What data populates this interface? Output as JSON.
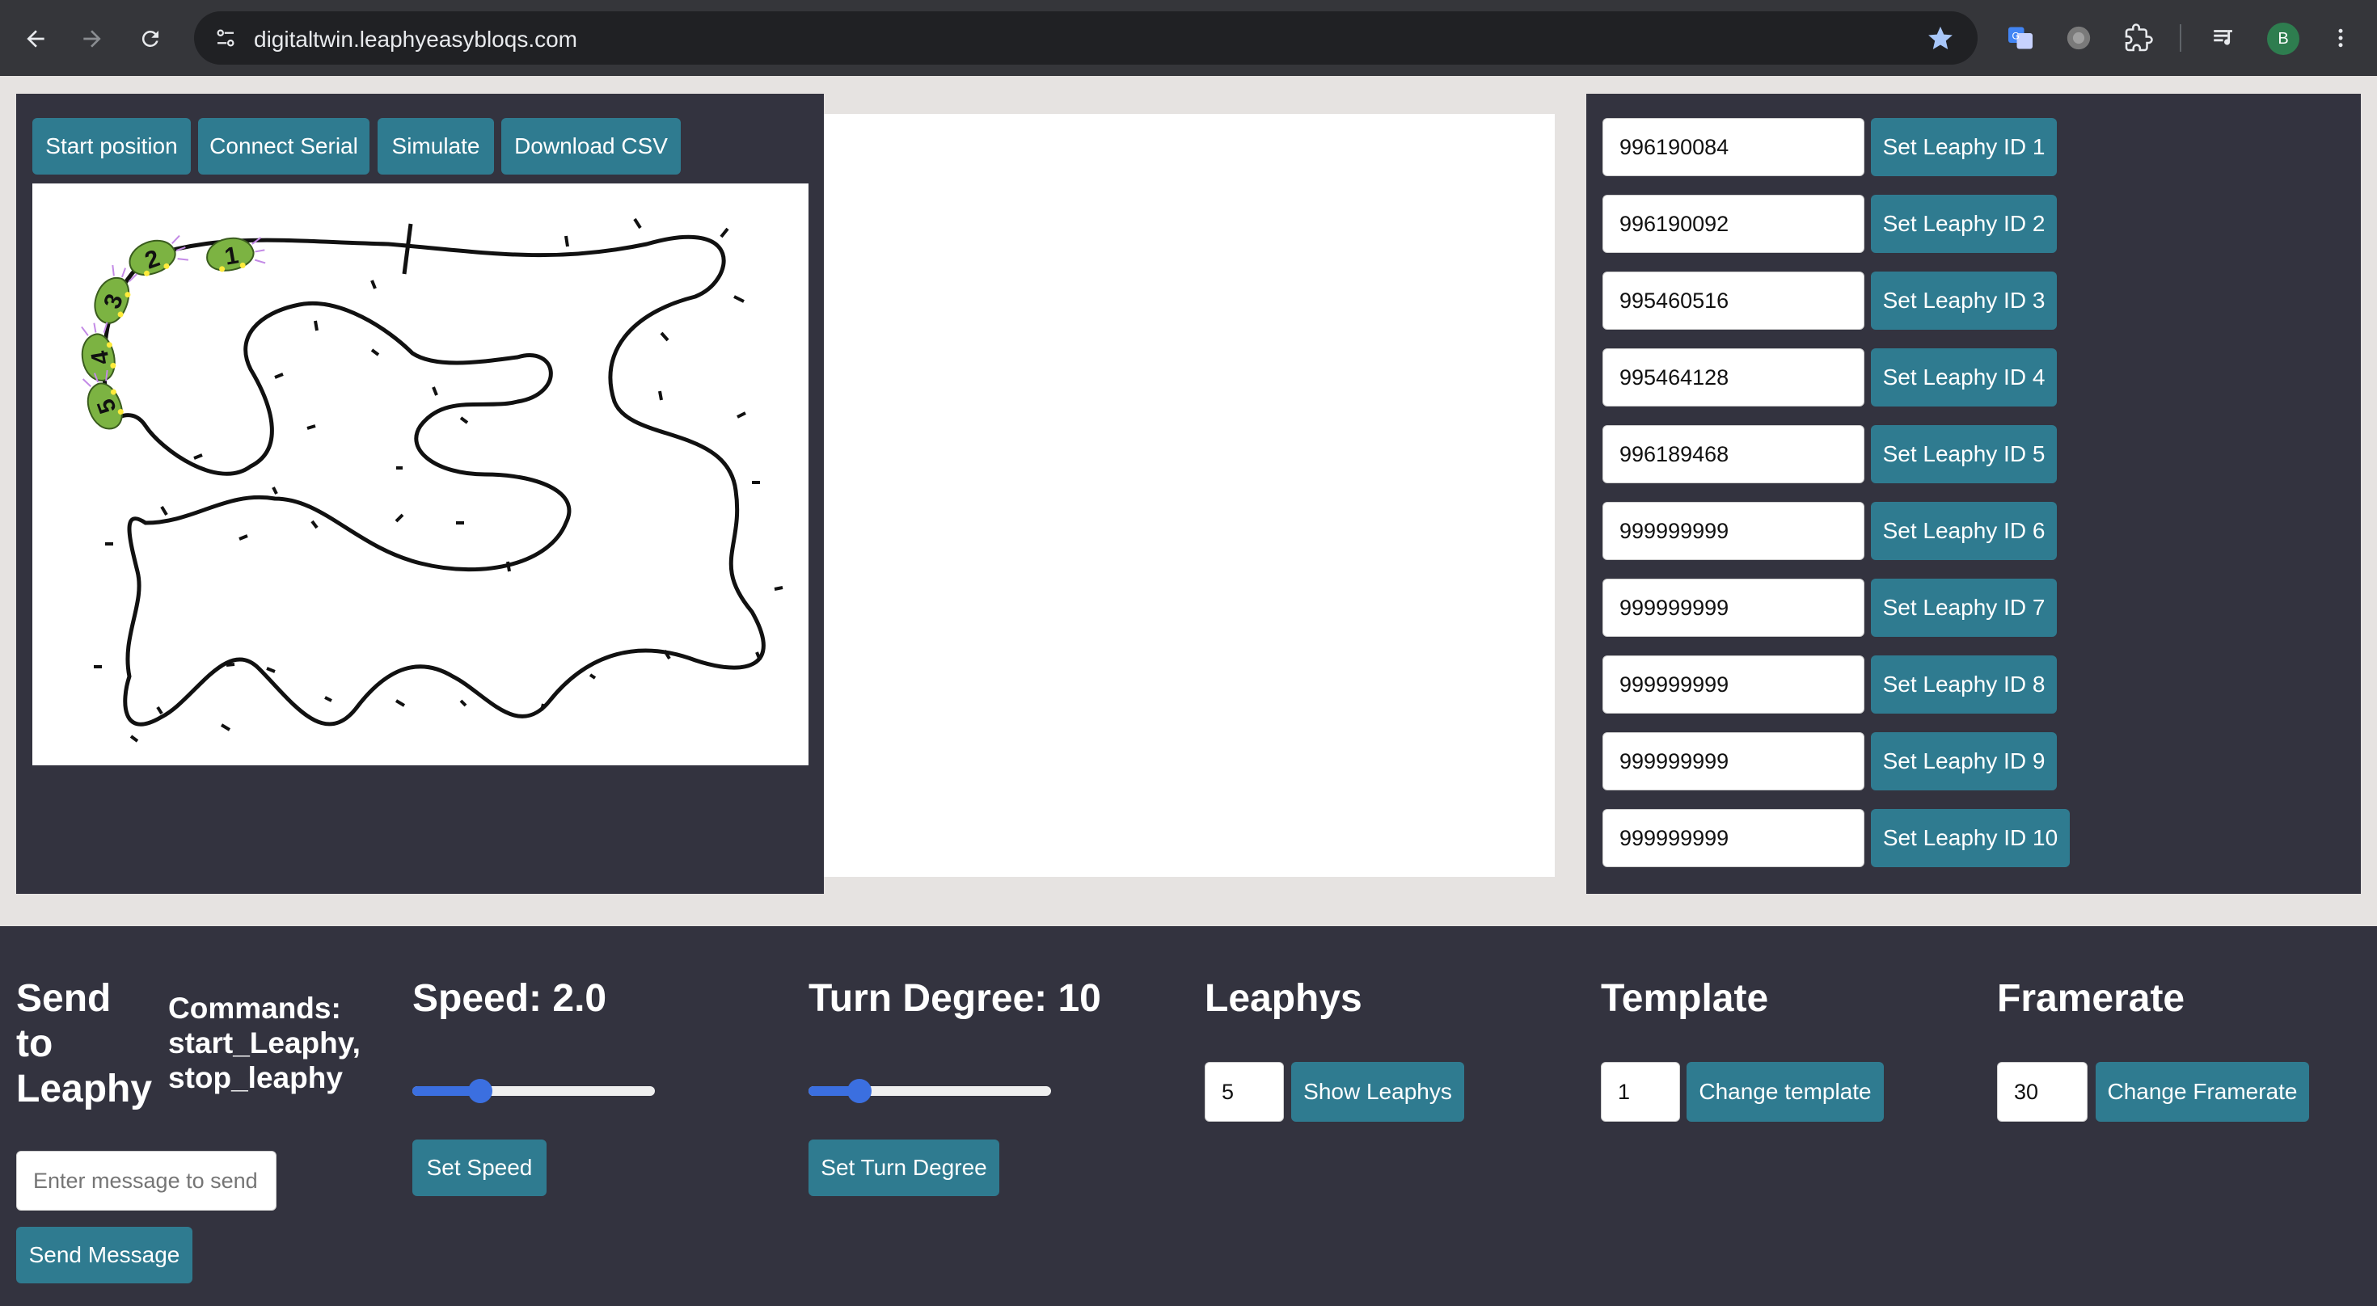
{
  "browser": {
    "url": "digitaltwin.leaphyeasybloqs.com",
    "profile_initial": "B",
    "icons": [
      "back-arrow-icon",
      "forward-arrow-icon",
      "reload-icon",
      "site-settings-icon",
      "bookmark-star-icon",
      "translate-extension-icon",
      "extension-circle-icon",
      "puzzle-extensions-icon",
      "media-controls-icon",
      "profile-avatar",
      "more-vert-icon"
    ]
  },
  "toolbar": {
    "start_position": "Start position",
    "connect_serial": "Connect Serial",
    "simulate": "Simulate",
    "download_csv": "Download CSV"
  },
  "track": {
    "robots": [
      {
        "label": "1"
      },
      {
        "label": "2"
      },
      {
        "label": "3"
      },
      {
        "label": "4"
      },
      {
        "label": "5"
      }
    ]
  },
  "leaphy_ids": [
    {
      "value": "996190084",
      "button": "Set Leaphy ID 1"
    },
    {
      "value": "996190092",
      "button": "Set Leaphy ID 2"
    },
    {
      "value": "995460516",
      "button": "Set Leaphy ID 3"
    },
    {
      "value": "995464128",
      "button": "Set Leaphy ID 4"
    },
    {
      "value": "996189468",
      "button": "Set Leaphy ID 5"
    },
    {
      "value": "999999999",
      "button": "Set Leaphy ID 6"
    },
    {
      "value": "999999999",
      "button": "Set Leaphy ID 7"
    },
    {
      "value": "999999999",
      "button": "Set Leaphy ID 8"
    },
    {
      "value": "999999999",
      "button": "Set Leaphy ID 9"
    },
    {
      "value": "999999999",
      "button": "Set Leaphy ID 10"
    }
  ],
  "send": {
    "title_line1": "Send",
    "title_line2": "to",
    "title_line3": "Leaphy",
    "commands_line1": "Commands:",
    "commands_line2": "start_Leaphy,",
    "commands_line3": "stop_leaphy",
    "placeholder": "Enter message to send",
    "button": "Send Message"
  },
  "speed": {
    "title": "Speed: 2.0",
    "slider_fraction": 0.28,
    "button": "Set Speed"
  },
  "turn": {
    "title": "Turn Degree: 10",
    "slider_fraction": 0.21,
    "button": "Set Turn Degree"
  },
  "leaphys": {
    "title": "Leaphys",
    "value": "5",
    "button": "Show Leaphys"
  },
  "template": {
    "title": "Template",
    "value": "1",
    "button": "Change template"
  },
  "framerate": {
    "title": "Framerate",
    "value": "30",
    "button": "Change Framerate"
  },
  "colors": {
    "button": "#2f7b90",
    "panel": "#33333f",
    "page": "#e6e3e1",
    "slider": "#3b6fe0",
    "robot": "#7cb342"
  }
}
